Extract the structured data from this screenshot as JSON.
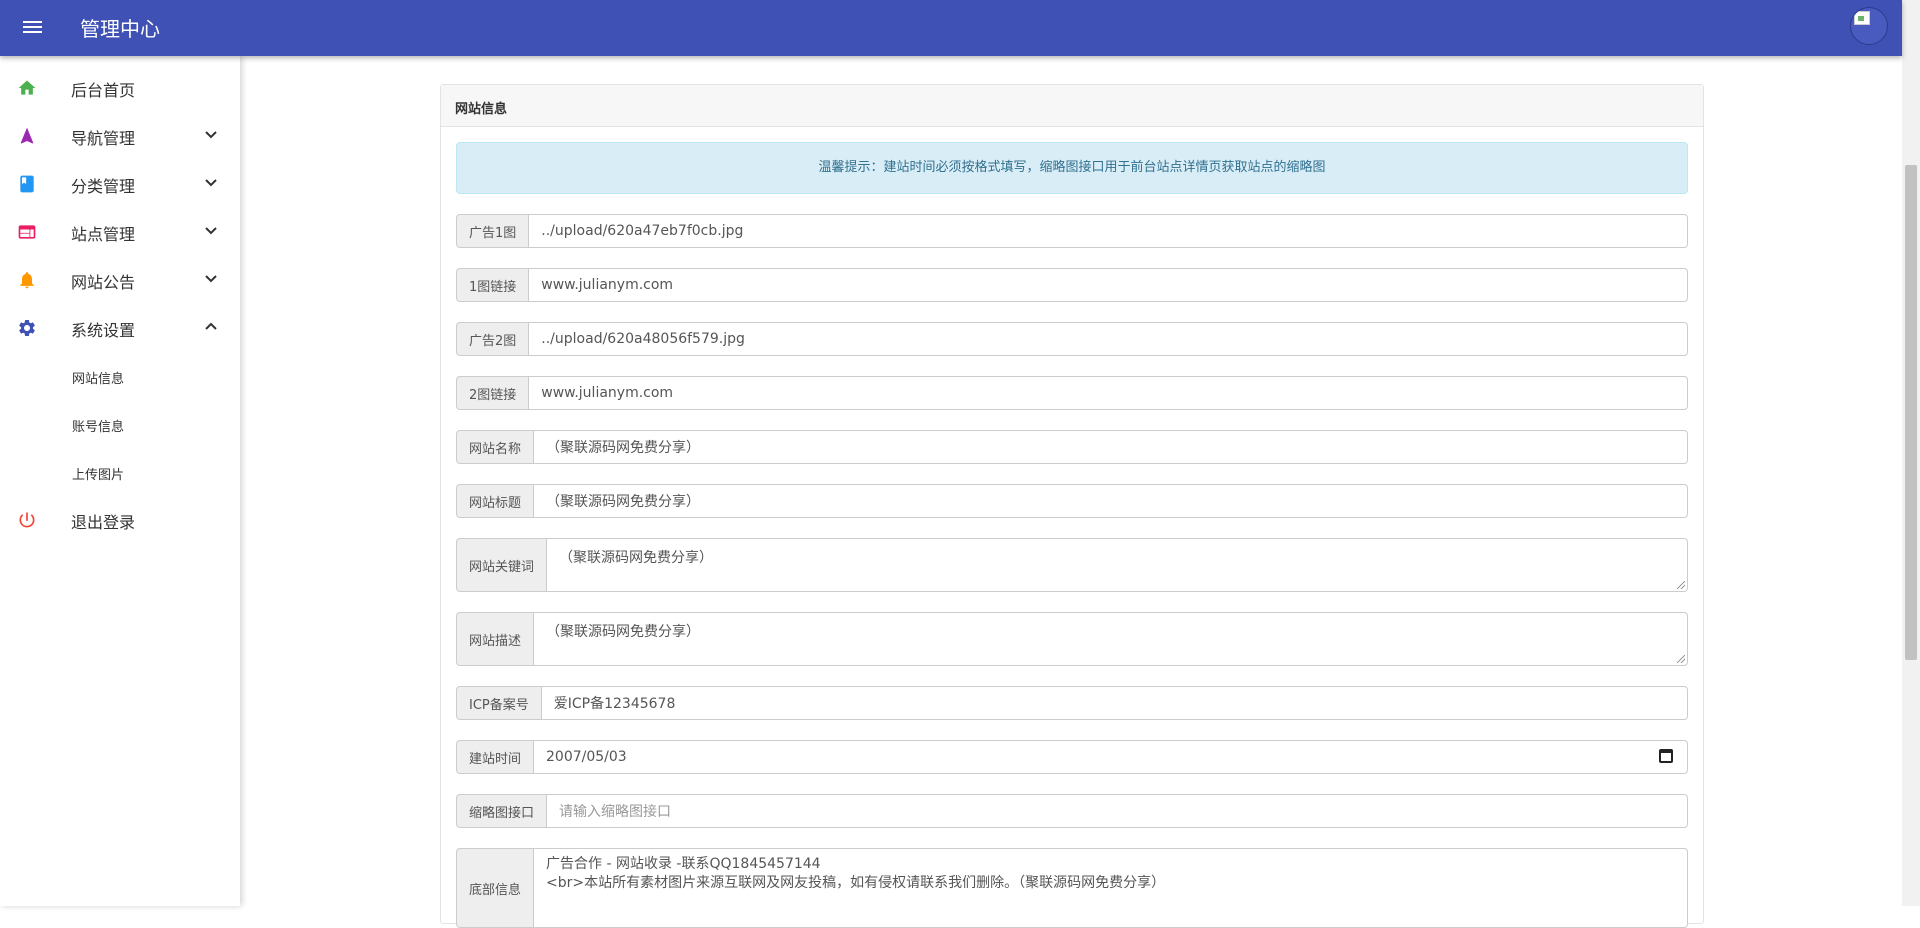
{
  "header": {
    "title": "管理中心",
    "bg_color": "#3f51b5"
  },
  "sidebar": {
    "items": [
      {
        "label": "后台首页",
        "icon": "home-icon",
        "color": "#4caf50"
      },
      {
        "label": "导航管理",
        "icon": "navigation-icon",
        "color": "#9c27b0",
        "expandable": true
      },
      {
        "label": "分类管理",
        "icon": "book-icon",
        "color": "#2196f3",
        "expandable": true
      },
      {
        "label": "站点管理",
        "icon": "web-icon",
        "color": "#e91e63",
        "expandable": true
      },
      {
        "label": "网站公告",
        "icon": "bell-icon",
        "color": "#ff9800",
        "expandable": true
      },
      {
        "label": "系统设置",
        "icon": "gear-icon",
        "color": "#3f51b5",
        "expandable": true,
        "expanded": true
      },
      {
        "label": "退出登录",
        "icon": "power-icon",
        "color": "#f44336"
      }
    ],
    "sub_items": [
      "网站信息",
      "账号信息",
      "上传图片"
    ]
  },
  "card": {
    "title": "网站信息",
    "notice": "温馨提示：建站时间必须按格式填写，缩略图接口用于前台站点详情页获取站点的缩略图"
  },
  "form": {
    "ad1_label": "广告1图",
    "ad1_value": "../upload/620a47eb7f0cb.jpg",
    "link1_label": "1图链接",
    "link1_value": "www.julianym.com",
    "ad2_label": "广告2图",
    "ad2_value": "../upload/620a48056f579.jpg",
    "link2_label": "2图链接",
    "link2_value": "www.julianym.com",
    "site_name_label": "网站名称",
    "site_name_value": "（聚联源码网免费分享）",
    "site_title_label": "网站标题",
    "site_title_value": "（聚联源码网免费分享）",
    "keywords_label": "网站关键词",
    "keywords_value": "（聚联源码网免费分享）",
    "description_label": "网站描述",
    "description_value": "（聚联源码网免费分享）",
    "icp_label": "ICP备案号",
    "icp_value": "爱ICP备12345678",
    "build_date_label": "建站时间",
    "build_date_value": "2007/05/03",
    "thumb_api_label": "缩略图接口",
    "thumb_api_placeholder": "请输入缩略图接口",
    "footer_label": "底部信息",
    "footer_line1": "广告合作 - 网站收录 -联系QQ1845457144",
    "footer_line2": "<br>本站所有素材图片来源互联网及网友投稿，如有侵权请联系我们删除。（聚联源码网免费分享）"
  }
}
